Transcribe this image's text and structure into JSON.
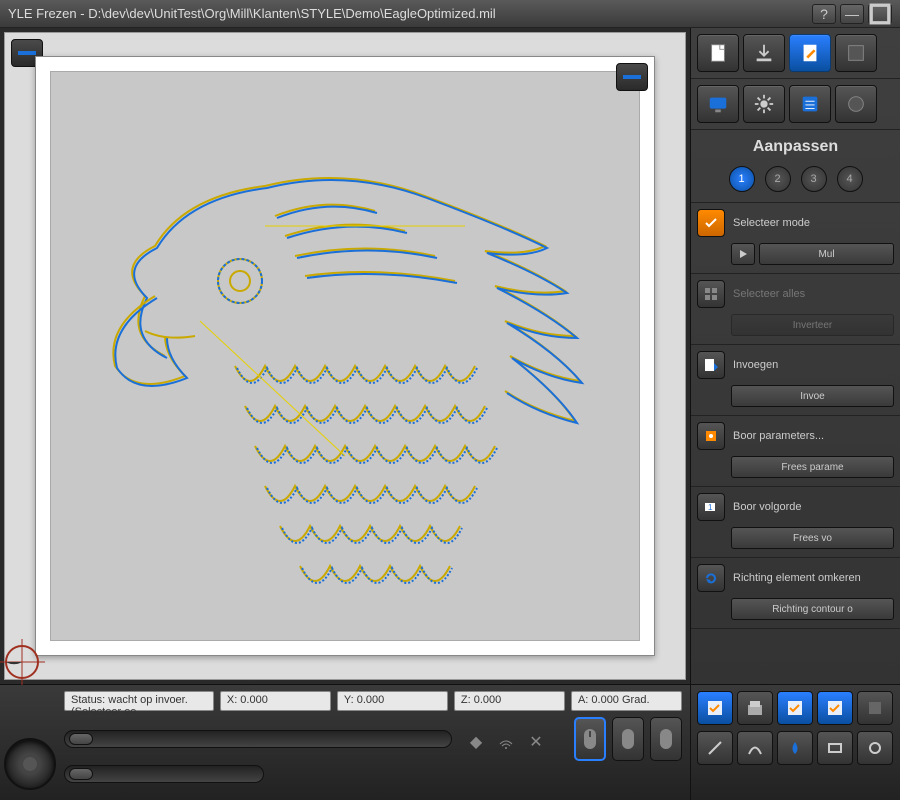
{
  "titlebar": {
    "text": "YLE Frezen - D:\\dev\\dev\\UnitTest\\Org\\Mill\\Klanten\\STYLE\\Demo\\EagleOptimized.mil",
    "help": "?",
    "minimize": "—"
  },
  "panel": {
    "section_title": "Aanpassen",
    "steps": [
      "1",
      "2",
      "3",
      "4"
    ],
    "groups": {
      "select_mode": {
        "label": "Selecteer mode",
        "btn": "Mul"
      },
      "select_all": {
        "label": "Selecteer alles",
        "btn": "Inverteer"
      },
      "insert": {
        "label": "Invoegen",
        "btn": "Invoe"
      },
      "drill_params": {
        "label": "Boor parameters...",
        "btn": "Frees parame"
      },
      "drill_order": {
        "label": "Boor volgorde",
        "btn": "Frees vo"
      },
      "direction": {
        "label": "Richting element omkeren",
        "btn": "Richting contour o"
      }
    }
  },
  "status": {
    "text": "Status: wacht op invoer. (Selecteer ee",
    "x": "X: 0.000",
    "y": "Y: 0.000",
    "z": "Z: 0.000",
    "a": "A: 0.000 Grad."
  },
  "colors": {
    "accent": "#2a7fff",
    "orange": "#ff8a00",
    "toolpath1": "#c9a900",
    "toolpath2": "#1a6fd9"
  }
}
